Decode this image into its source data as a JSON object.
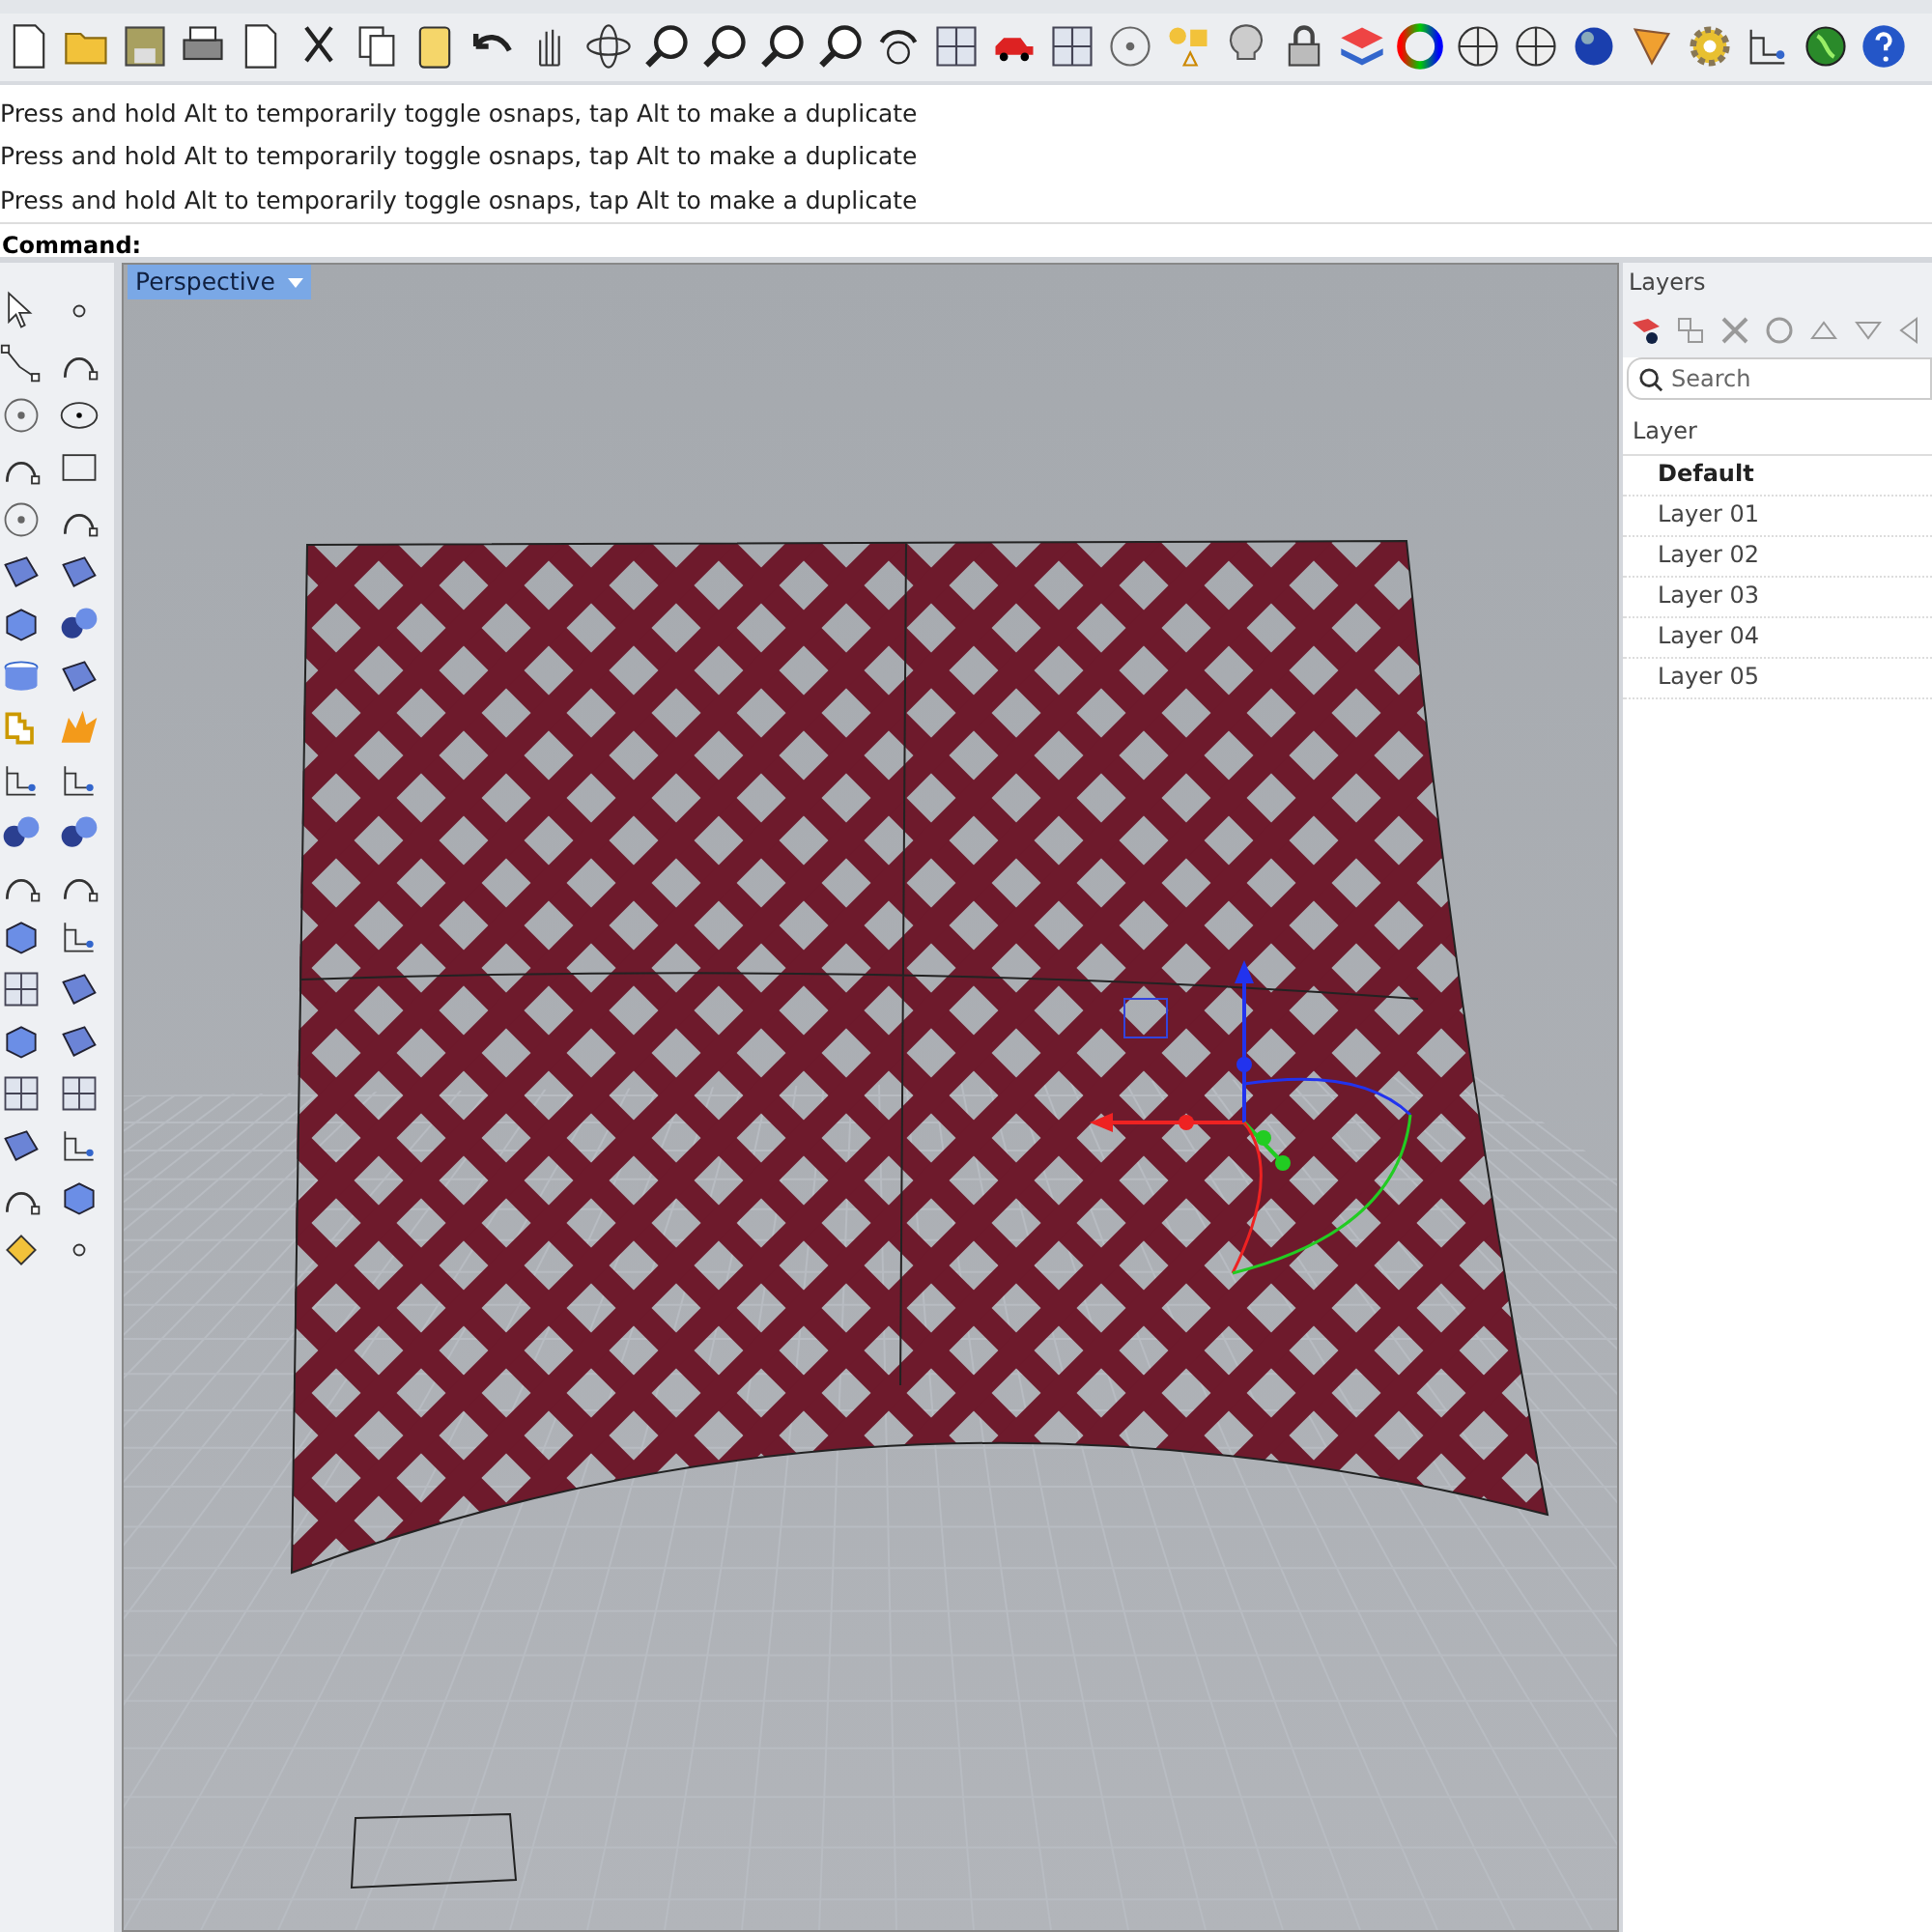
{
  "command_history": [
    "Press and hold Alt to temporarily toggle osnaps, tap Alt to make a duplicate",
    "Press and hold Alt to temporarily toggle osnaps, tap Alt to make a duplicate",
    "Press and hold Alt to temporarily toggle osnaps, tap Alt to make a duplicate"
  ],
  "command_prompt": "Command:",
  "viewport": {
    "title": "Perspective"
  },
  "layers_panel": {
    "title": "Layers",
    "search": {
      "placeholder": "Search"
    },
    "column": "Layer",
    "layers": [
      {
        "name": "Default",
        "current": true
      },
      {
        "name": "Layer 01",
        "current": false
      },
      {
        "name": "Layer 02",
        "current": false
      },
      {
        "name": "Layer 03",
        "current": false
      },
      {
        "name": "Layer 04",
        "current": false
      },
      {
        "name": "Layer 05",
        "current": false
      }
    ]
  }
}
